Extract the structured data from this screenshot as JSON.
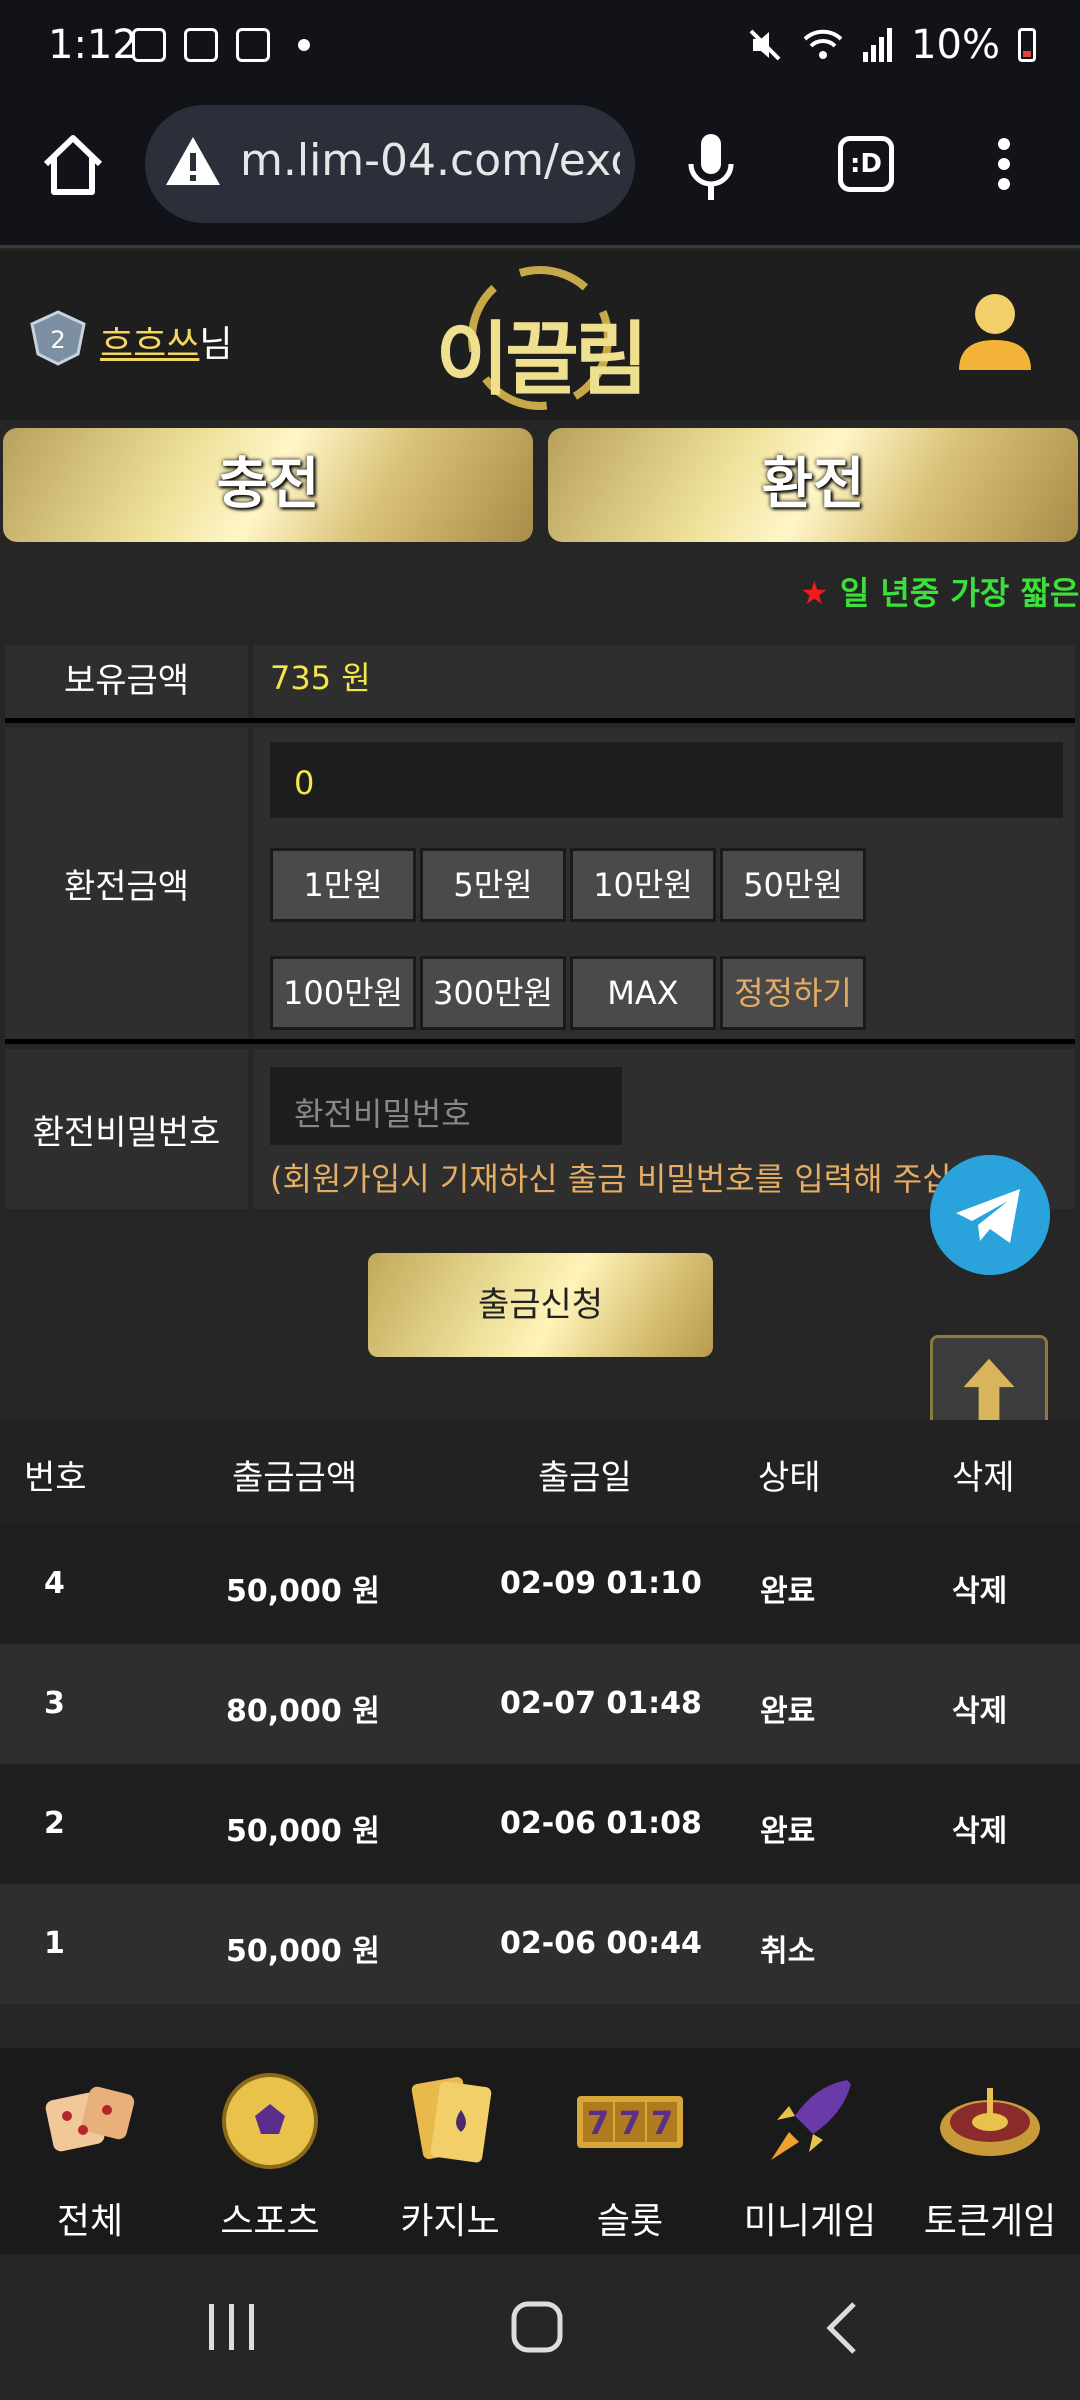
{
  "status": {
    "time": "1:12",
    "battery": "10%"
  },
  "browser": {
    "url": "m.lim-04.com/exc",
    "tabs_label": ":D"
  },
  "header": {
    "nickname": "흐흐쓰",
    "suffix": "님",
    "logo": "이끌림",
    "rank": "2"
  },
  "actions": {
    "charge": "충전",
    "exchange": "환전"
  },
  "marquee": {
    "star": "★",
    "text": "일 년중 가장 짧은"
  },
  "form": {
    "balance_label": "보유금액",
    "balance_value": "735 원",
    "amount_label": "환전금액",
    "amount_value": "0",
    "chips": [
      "1만원",
      "5만원",
      "10만원",
      "50만원",
      "100만원",
      "300만원",
      "MAX",
      "정정하기"
    ],
    "password_label": "환전비밀번호",
    "password_placeholder": "환전비밀번호",
    "password_note": "(회원가입시 기재하신 출금 비밀번호를 입력해 주십시오)",
    "submit": "출금신청"
  },
  "table": {
    "headers": [
      "번호",
      "출금금액",
      "출금일",
      "상태",
      "삭제"
    ],
    "rows": [
      [
        "4",
        "50,000 원",
        "02-09 01:10",
        "완료",
        "삭제"
      ],
      [
        "3",
        "80,000 원",
        "02-07 01:48",
        "완료",
        "삭제"
      ],
      [
        "2",
        "50,000 원",
        "02-06 01:08",
        "완료",
        "삭제"
      ],
      [
        "1",
        "50,000 원",
        "02-06 00:44",
        "취소",
        ""
      ]
    ]
  },
  "bottom_nav": [
    {
      "label": "전체",
      "icon": "dice-icon"
    },
    {
      "label": "스포츠",
      "icon": "soccer-ball-icon"
    },
    {
      "label": "카지노",
      "icon": "cards-icon"
    },
    {
      "label": "슬롯",
      "icon": "slot-777-icon"
    },
    {
      "label": "미니게임",
      "icon": "rocket-icon"
    },
    {
      "label": "토큰게임",
      "icon": "roulette-icon"
    }
  ]
}
